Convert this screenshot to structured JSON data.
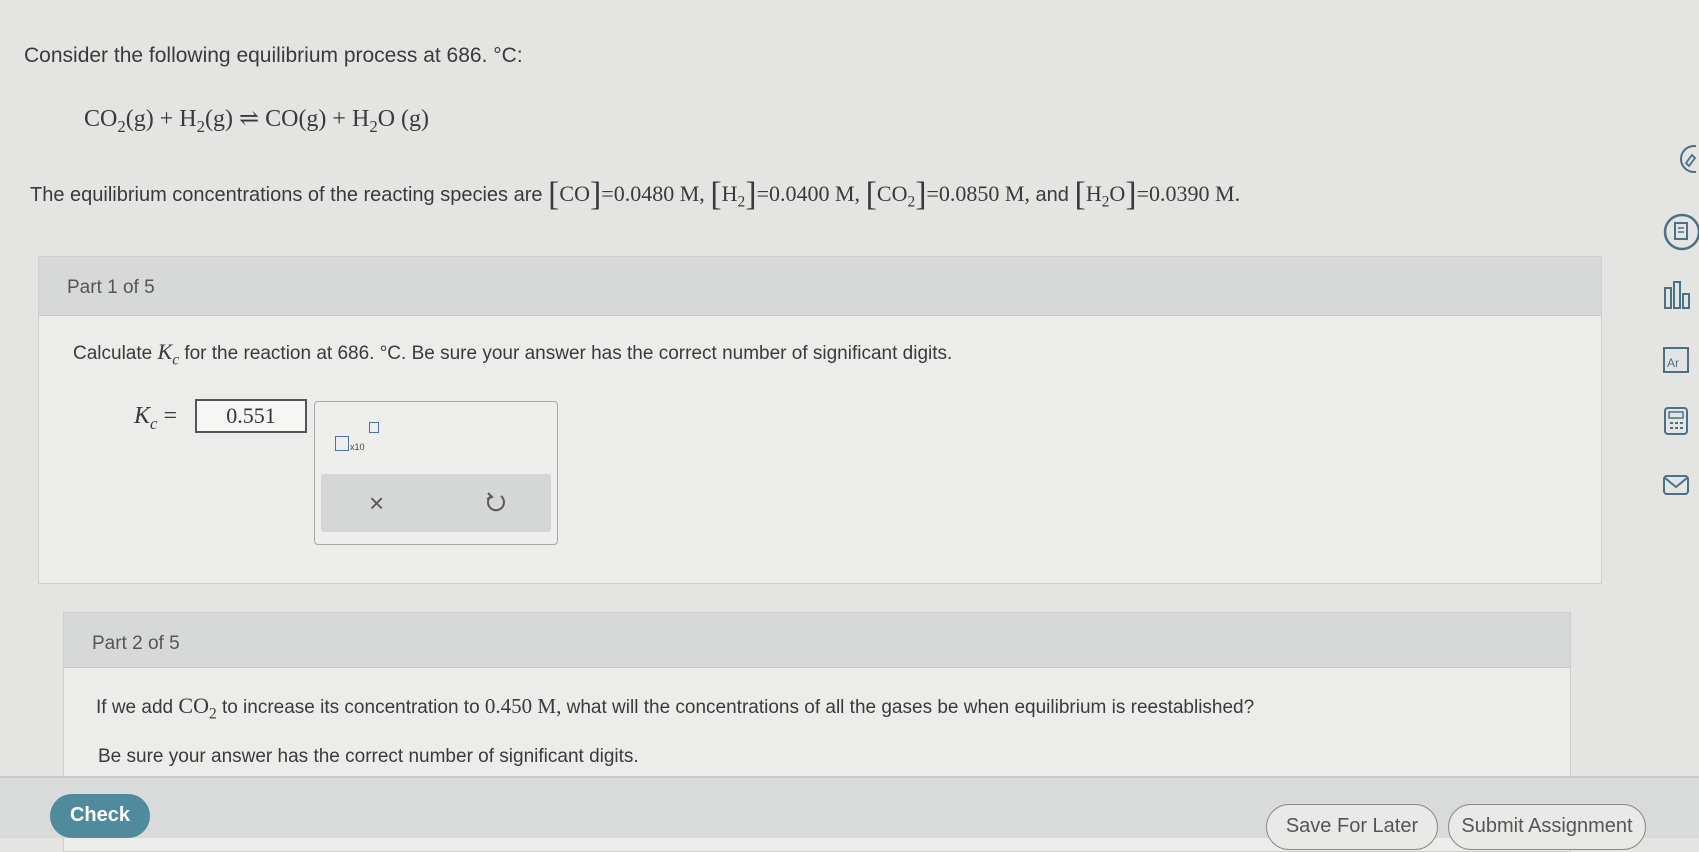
{
  "problem": {
    "intro": "Consider the following equilibrium process at 686. °C:",
    "equation": {
      "r1": "CO",
      "r1_sub": "2",
      "r1_state": "(g)",
      "plus1": "+",
      "r2": "H",
      "r2_sub": "2",
      "r2_state": "(g)",
      "arrow": "⇌",
      "p1": "CO",
      "p1_state": "(g)",
      "plus2": "+",
      "p2": "H",
      "p2_sub": "2",
      "p2_tail": "O",
      "p2_state": " (g)"
    },
    "conc_intro": "The equilibrium concentrations of the reacting species are",
    "concentrations": [
      {
        "species": "CO",
        "sub": "",
        "tail": "",
        "value": "=0.0480 M,"
      },
      {
        "species": "H",
        "sub": "2",
        "tail": "",
        "value": "=0.0400 M,"
      },
      {
        "species": "CO",
        "sub": "2",
        "tail": "",
        "value": "=0.0850 M,"
      },
      {
        "species": "H",
        "sub": "2",
        "tail": "O",
        "value": "=0.0390 M."
      }
    ],
    "and_word": "and"
  },
  "part1": {
    "label": "Part 1 of 5",
    "q_prefix": "Calculate",
    "q_k": "K",
    "q_k_sub": "c",
    "q_suffix": "for the reaction at 686. °C. Be sure your answer has the correct number of significant digits.",
    "kc_label": "K",
    "kc_sub": "c",
    "kc_eq": "=",
    "answer": "0.551",
    "x10_label": "x10",
    "clear_symbol": "×"
  },
  "part2": {
    "label": "Part 2 of 5",
    "q_prefix": "If we add",
    "q_species": "CO",
    "q_species_sub": "2",
    "q_middle": "to increase its concentration to",
    "q_value": "0.450 M,",
    "q_suffix": "what will the concentrations of all the gases be when equilibrium is reestablished?",
    "q2": "Be sure your answer has the correct number of significant digits."
  },
  "footer": {
    "check": "Check",
    "save": "Save For Later",
    "submit": "Submit Assignment"
  },
  "sidebar": {
    "icons": [
      "pencil-icon",
      "reference-icon",
      "chart-icon",
      "periodic-table-icon",
      "calculator-icon",
      "mail-icon"
    ],
    "accent": "#4a7185"
  }
}
